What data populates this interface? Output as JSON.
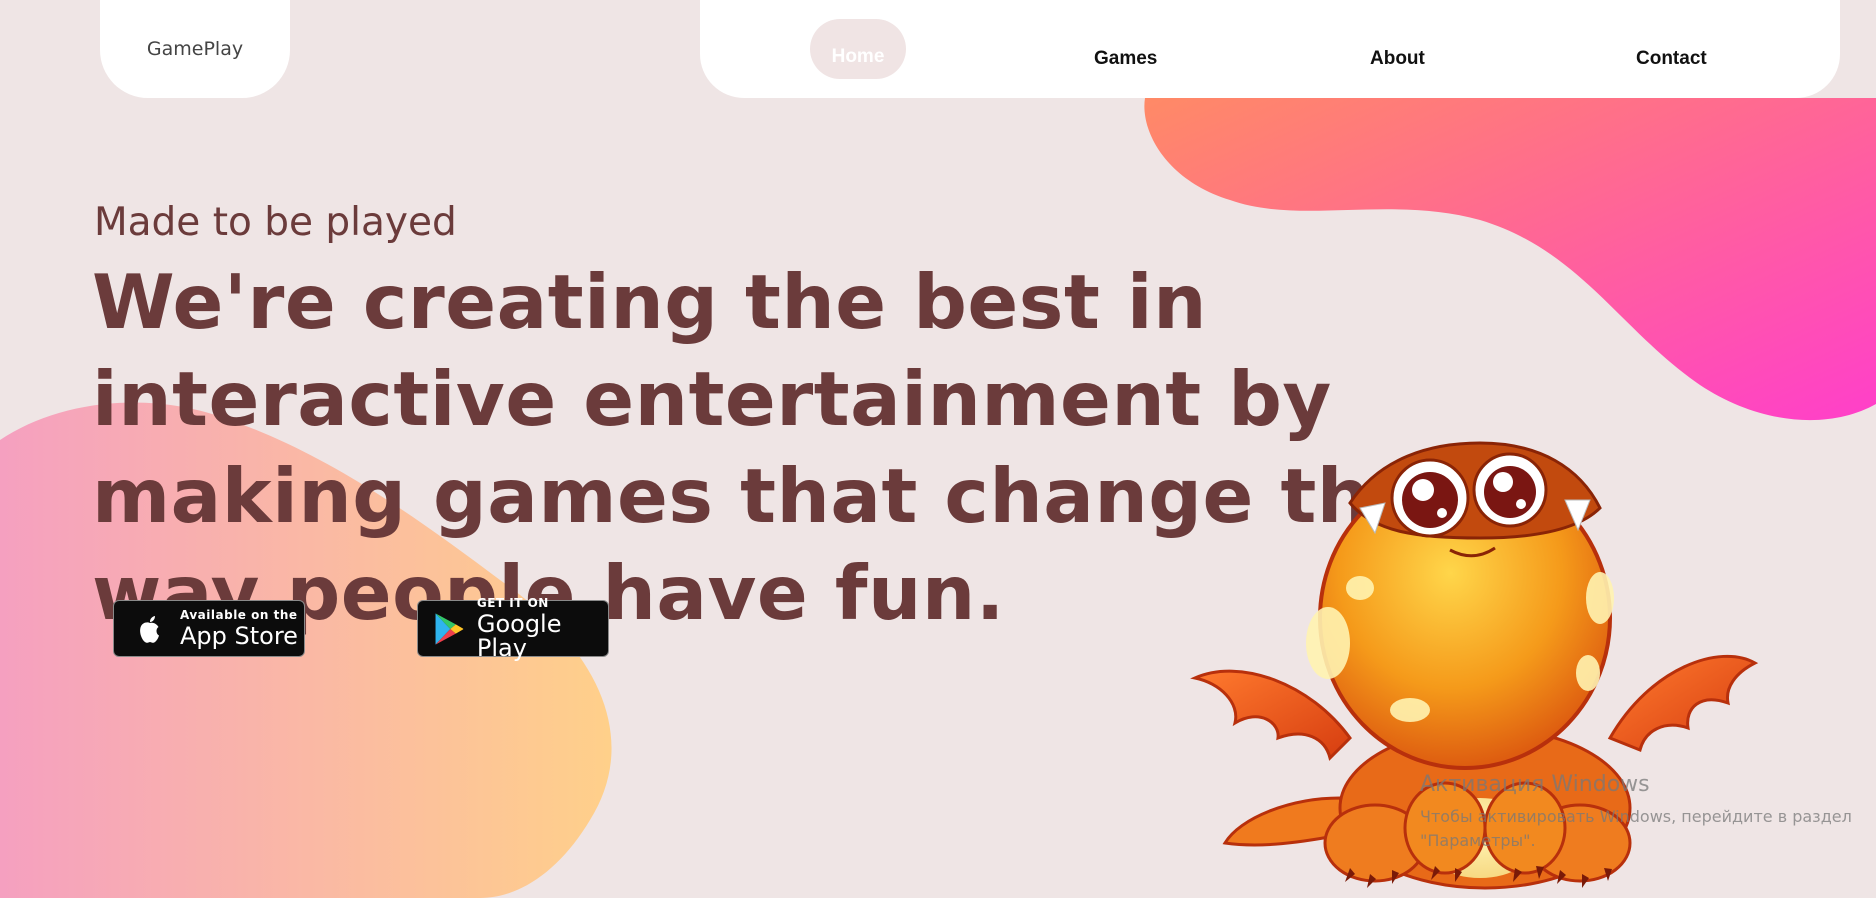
{
  "logo": {
    "text": "GamePlay"
  },
  "nav": {
    "items": [
      {
        "label": "Home",
        "active": true
      },
      {
        "label": "Games",
        "active": false
      },
      {
        "label": "About",
        "active": false
      },
      {
        "label": "Contact",
        "active": false
      }
    ]
  },
  "hero": {
    "eyebrow": "Made to be played",
    "headline": "We're creating the best in interactive entertainment by making games that change the way people have fun."
  },
  "stores": {
    "appstore": {
      "small": "Available on the",
      "big": "App Store"
    },
    "googleplay": {
      "small": "GET IT ON",
      "big": "Google Play"
    }
  },
  "watermark": {
    "title": "Активация Windows",
    "line1": "Чтобы активировать Windows, перейдите в раздел",
    "line2": "\"Параметры\"."
  },
  "colors": {
    "background": "#efe5e5",
    "text": "#6b3b3b",
    "blob_top": [
      "#ff8a66",
      "#ff3fca"
    ],
    "blob_left": [
      "#f5a0c0",
      "#ffd08a"
    ]
  },
  "images": {
    "mascot": "orange-baby-dragon"
  }
}
